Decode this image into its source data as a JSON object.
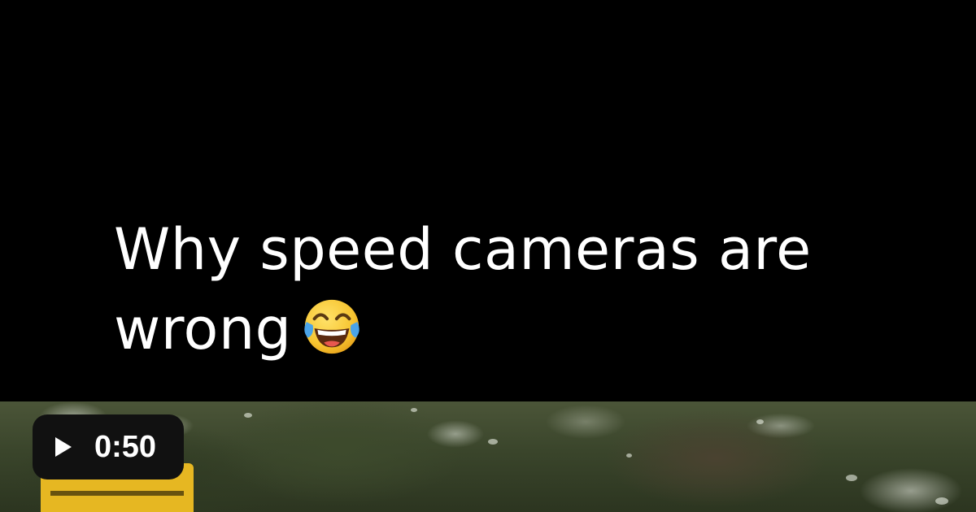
{
  "video": {
    "caption_line1": "Why speed cameras are",
    "caption_line2": "wrong",
    "caption_emoji": "face-with-tears-of-joy",
    "duration": "0:50",
    "play_icon": "play-icon"
  },
  "colors": {
    "background": "#000000",
    "caption_text": "#ffffff",
    "badge_background": "#111111",
    "camera_yellow": "#e6b722"
  }
}
